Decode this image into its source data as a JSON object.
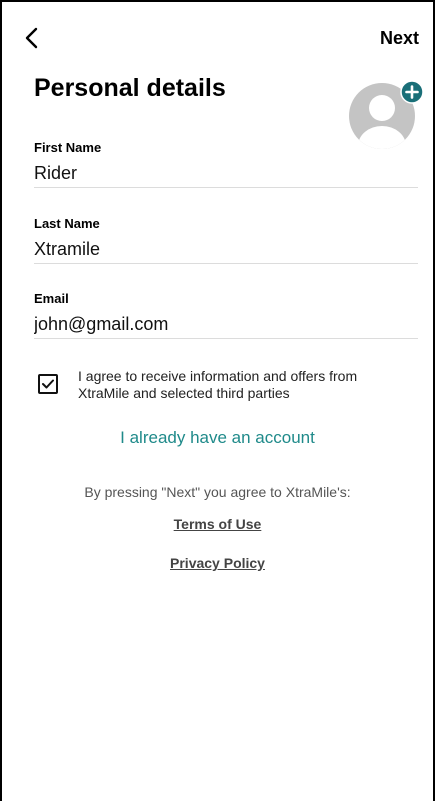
{
  "header": {
    "next_label": "Next"
  },
  "page": {
    "title": "Personal details"
  },
  "form": {
    "first_name": {
      "label": "First Name",
      "value": "Rider"
    },
    "last_name": {
      "label": "Last Name",
      "value": "Xtramile"
    },
    "email": {
      "label": "Email",
      "value": "john@gmail.com"
    }
  },
  "consent": {
    "checked": true,
    "text": "I agree to receive information and offers from XtraMile and selected third parties"
  },
  "links": {
    "account": "I already have an account",
    "agree_intro": "By pressing \"Next\" you agree to XtraMile's:",
    "terms": "Terms of Use",
    "privacy": "Privacy Policy"
  },
  "colors": {
    "accent": "#1f8a8a",
    "avatar_bg": "#c4c4c4",
    "avatar_badge": "#1a6f78"
  },
  "icons": {
    "back": "chevron-left-icon",
    "avatar": "user-avatar-icon",
    "avatar_add": "plus-circle-icon",
    "checkbox": "checkmark-icon"
  }
}
